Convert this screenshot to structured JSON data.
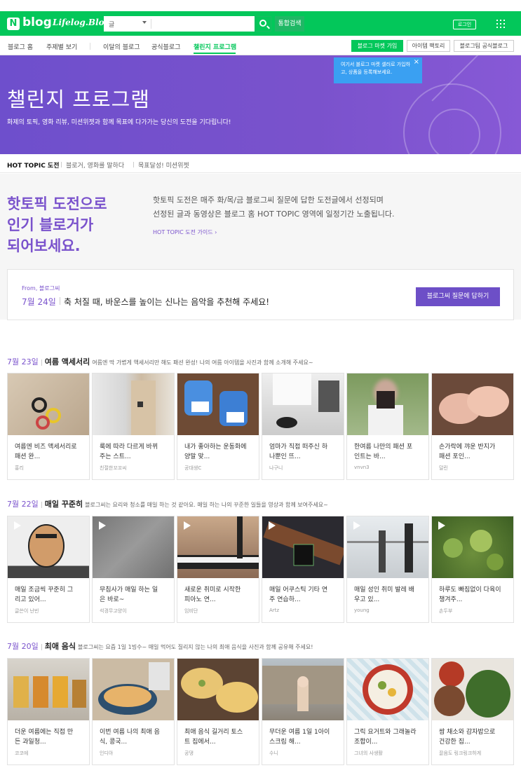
{
  "header": {
    "logo_n": "N",
    "logo_text": "blog",
    "lifelog": "Lifelog.Blog",
    "search_select": "글",
    "total_search": "통합검색",
    "login": "로그인"
  },
  "nav": {
    "items": [
      "블로그 홈",
      "주제별 보기",
      "이달의 블로그",
      "공식블로그",
      "챌린지 프로그램"
    ],
    "market_join": "블로그 마켓 가입",
    "item_factory": "아이템 팩토리",
    "official": "블로그팀 공식블로그"
  },
  "tooltip": {
    "text": "여기서 블로그 마켓 셀러로 가입하고, 상품을 등록해보세요.",
    "close": "×"
  },
  "banner": {
    "title": "챌린지 프로그램",
    "subtitle": "화제의 토픽, 영화 리뷰, 미션위젯과 함께 목표에 다가가는 당신의 도전을 기다립니다!"
  },
  "subtabs": [
    "HOT TOPIC 도전",
    "블로거, 영화를 말하다",
    "목표달성! 미션위젯"
  ],
  "intro": {
    "headline_1": "핫토픽 도전으로",
    "headline_2": "인기 블로거가",
    "headline_3": "되어보세요.",
    "desc_1": "핫토픽 도전은 매주 화/목/금 블로그씨 질문에 답한 도전글에서 선정되며",
    "desc_2": "선정된 글과 동영상은 블로그 홈 HOT TOPIC 영역에 일정기간 노출됩니다.",
    "guide": "HOT TOPIC 도전 가이드 ›"
  },
  "question": {
    "from": "From, 블로그씨",
    "date": "7월 24일",
    "text": "축 처질 때, 바운스를 높이는 신나는 음악을 추천해 주세요!",
    "button": "블로그씨 질문에 답하기"
  },
  "sections": [
    {
      "date": "7월 23일",
      "title": "여름 액세서리",
      "desc": "여름엔 딱 가볍게 액세서리만 해도 패션 완성! 나의 여름 아이템을 사진과 함께 소개해 주세요~",
      "cards": [
        {
          "c1": "여름엔 비즈 액세서리로",
          "c2": "패션 완...",
          "a": "홍리"
        },
        {
          "c1": "룩에 따라 다르게 바뀌",
          "c2": "주는 스트...",
          "a": "친절한꼬꼬씨"
        },
        {
          "c1": "내가 좋아하는 운동화에",
          "c2": "양말 맞...",
          "a": "공대생C"
        },
        {
          "c1": "엄마가 직접 떠주신 하",
          "c2": "나뿐인 뜨...",
          "a": "나구니"
        },
        {
          "c1": "한여름 나만의 패션 포",
          "c2": "인트는 바...",
          "a": "vnvn3"
        },
        {
          "c1": "손가락에 꺄운 반지가",
          "c2": "패션 포인...",
          "a": "덜린"
        }
      ]
    },
    {
      "date": "7월 22일",
      "title": "매일 꾸준히",
      "desc": "블로그씨는 요리와 청소를 매일 하는 것 같아요. 매일 하는 나의 꾸준한 일들을 영상과 함께 보여주세요~",
      "cards": [
        {
          "c1": "매일 조금씩 꾸준히 그",
          "c2": "리고 있어...",
          "a": "글쓴이 난빈"
        },
        {
          "c1": "무침사가 매일 하는 일",
          "c2": "은 바로~",
          "a": "석경무고양이"
        },
        {
          "c1": "새로운 취미로 시작한",
          "c2": "피아노 연...",
          "a": "임비단"
        },
        {
          "c1": "매일 어쿠스틱 기타 연",
          "c2": "주 연습하...",
          "a": "Artz"
        },
        {
          "c1": "매일 성인 취미 발레 배",
          "c2": "우고 있...",
          "a": "young"
        },
        {
          "c1": "하루도 빠짐없이 다육이",
          "c2": "챙겨주...",
          "a": "손두부"
        }
      ]
    },
    {
      "date": "7월 20일",
      "title": "최애 음식",
      "desc": "블로그씨는 요즘 1일 1빙수~ 매일 먹어도 질리지 않는 나의 최애 음식을 사진과 함께 공유해 주세요!",
      "cards": [
        {
          "c1": "더운 여름에는 직접 만",
          "c2": "든 과일청...",
          "a": "코코에"
        },
        {
          "c1": "이번 여름 나의 최애 음",
          "c2": "식, 콩국...",
          "a": "인디아"
        },
        {
          "c1": "최애 음식 길거리 토스",
          "c2": "트 집에서...",
          "a": "공댕"
        },
        {
          "c1": "무더운 여름 1일 1아이",
          "c2": "스크림 해...",
          "a": "수니"
        },
        {
          "c1": "그릭 요거트와 그래놀라",
          "c2": "조합이...",
          "a": "그녀의 사생활"
        },
        {
          "c1": "쌈 채소와 감자밥으로",
          "c2": "건강한 집...",
          "a": "끌음도 링크링크하게"
        }
      ]
    }
  ]
}
